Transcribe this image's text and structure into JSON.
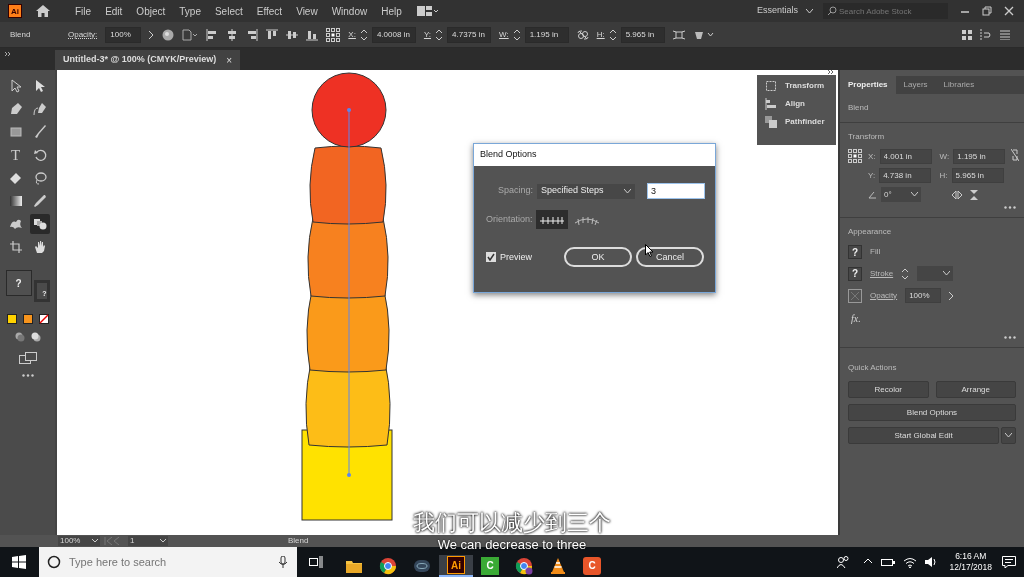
{
  "app_logo": "Ai",
  "menu": [
    "File",
    "Edit",
    "Object",
    "Type",
    "Select",
    "Effect",
    "View",
    "Window",
    "Help"
  ],
  "workspace": "Essentials",
  "stock_search": {
    "placeholder": "Search Adobe Stock"
  },
  "control_bar": {
    "selection": "Blend",
    "opacity_label": "Opacity:",
    "opacity": "100%",
    "fields": [
      {
        "label": "X:",
        "value": "4.0008 in"
      },
      {
        "label": "Y:",
        "value": "4.7375 in"
      },
      {
        "label": "W:",
        "value": "1.195 in"
      },
      {
        "label": "H:",
        "value": "5.965 in"
      }
    ]
  },
  "document_tab": {
    "title": "Untitled-3* @ 100% (CMYK/Preview)",
    "close": "×"
  },
  "tools": [
    {
      "kind": "selection",
      "selected": false
    },
    {
      "kind": "direct",
      "selected": false
    },
    {
      "kind": "pen",
      "selected": false
    },
    {
      "kind": "curvature",
      "selected": false
    },
    {
      "kind": "rectangle",
      "selected": false
    },
    {
      "kind": "brush",
      "selected": false
    },
    {
      "kind": "type",
      "label": "T",
      "selected": false
    },
    {
      "kind": "rotate",
      "selected": false
    },
    {
      "kind": "eraser",
      "selected": false
    },
    {
      "kind": "lasso",
      "selected": false
    },
    {
      "kind": "gradient",
      "selected": false
    },
    {
      "kind": "eyedropper",
      "selected": false
    },
    {
      "kind": "warp",
      "selected": false
    },
    {
      "kind": "blend",
      "selected": true
    },
    {
      "kind": "artboard",
      "selected": false
    },
    {
      "kind": "hand",
      "selected": false
    }
  ],
  "fill_stroke": {
    "fill": "?",
    "stroke": "?"
  },
  "swatches": [
    {
      "color": "#ffd200"
    },
    {
      "color": "#f7941d"
    }
  ],
  "floating_panel": [
    "Transform",
    "Align",
    "Pathfinder"
  ],
  "properties": {
    "tabs": [
      {
        "label": "Properties",
        "selected": true
      },
      {
        "label": "Layers",
        "selected": false
      },
      {
        "label": "Libraries",
        "selected": false
      }
    ],
    "selection": "Blend",
    "transform": {
      "title": "Transform",
      "fields": [
        {
          "label": "X:",
          "value": "4.001 in"
        },
        {
          "label": "W:",
          "value": "1.195 in"
        },
        {
          "label": "Y:",
          "value": "4.738 in"
        },
        {
          "label": "H:",
          "value": "5.965 in"
        }
      ],
      "angle": "0°"
    },
    "appearance": {
      "title": "Appearance",
      "fill_label": "Fill",
      "fill": "?",
      "stroke_label": "Stroke",
      "stroke": "?",
      "opacity_label": "Opacity",
      "opacity": "100%",
      "effects": "fx."
    },
    "quick_actions": {
      "title": "Quick Actions",
      "buttons": [
        "Recolor",
        "Arrange",
        "Blend Options",
        "Start Global Edit"
      ]
    }
  },
  "dialog": {
    "title": "Blend Options",
    "spacing_label": "Spacing:",
    "spacing": "Specified Steps",
    "steps": "3",
    "orientation_label": "Orientation:",
    "orientation": [
      {
        "selected": true
      },
      {
        "selected": false
      }
    ],
    "preview": {
      "label": "Preview",
      "checked": true
    },
    "buttons": [
      "OK",
      "Cancel"
    ]
  },
  "status_bar": {
    "zoom": "100%",
    "artboard": "1",
    "info": "Blend"
  },
  "subtitles": [
    "我们可以减少到三个",
    "We can decrease to three"
  ],
  "taskbar": {
    "search_placeholder": "Type here to search",
    "apps": [
      {
        "kind": "folder",
        "selected": false
      },
      {
        "kind": "browser",
        "selected": false
      },
      {
        "kind": "cloud",
        "selected": false
      },
      {
        "kind": "illustrator",
        "label": "Ai",
        "selected": true
      },
      {
        "kind": "camtasia",
        "label": "C",
        "selected": false
      },
      {
        "kind": "chrome-app",
        "selected": false
      },
      {
        "kind": "cone",
        "selected": false
      },
      {
        "kind": "recorder",
        "label": "C",
        "selected": false
      }
    ],
    "time": "6:16 AM",
    "date": "12/17/2018"
  }
}
